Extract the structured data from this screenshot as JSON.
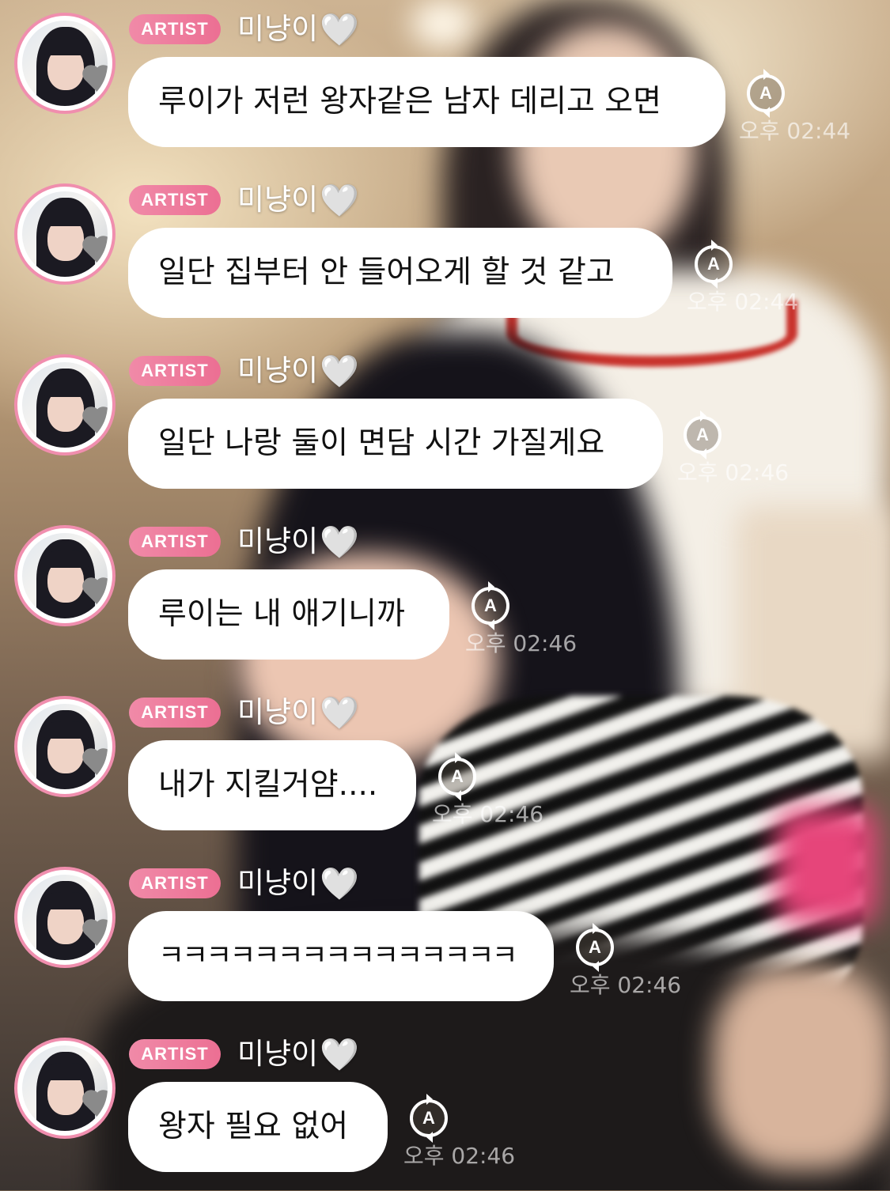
{
  "colors": {
    "badge_pink": "#ec6f93",
    "avatar_ring": "#f08eae",
    "bubble": "#ffffff",
    "text": "#111111",
    "timestamp": "rgba(255,255,255,0.62)"
  },
  "icons": {
    "heart": "🤍",
    "translate": "A"
  },
  "messages": [
    {
      "badge": "ARTIST",
      "nickname": "미냥이",
      "text": "루이가 저런 왕자같은 남자 데리고 오면",
      "time": "오후 02:44"
    },
    {
      "badge": "ARTIST",
      "nickname": "미냥이",
      "text": "일단 집부터 안 들어오게 할 것 같고",
      "time": "오후 02:44"
    },
    {
      "badge": "ARTIST",
      "nickname": "미냥이",
      "text": "일단 나랑 둘이 면담 시간 가질게요",
      "time": "오후 02:46"
    },
    {
      "badge": "ARTIST",
      "nickname": "미냥이",
      "text": "루이는 내 애기니까",
      "time": "오후 02:46"
    },
    {
      "badge": "ARTIST",
      "nickname": "미냥이",
      "text": "내가 지킬거얌....",
      "time": "오후 02:46"
    },
    {
      "badge": "ARTIST",
      "nickname": "미냥이",
      "text": "ㅋㅋㅋㅋㅋㅋㅋㅋㅋㅋㅋㅋㅋㅋㅋ",
      "time": "오후 02:46"
    },
    {
      "badge": "ARTIST",
      "nickname": "미냥이",
      "text": "왕자 필요 없어",
      "time": "오후 02:46"
    }
  ]
}
